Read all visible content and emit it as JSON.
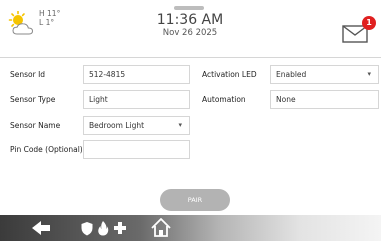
{
  "weather": {
    "high": "H 11°",
    "low": "L 1°",
    "icon": "partly-sunny-icon"
  },
  "clock": {
    "time": "11:36 AM",
    "date": "Nov 26 2025"
  },
  "notifications": {
    "icon": "envelope-icon",
    "count": "1"
  },
  "form": {
    "sensor_id_label": "Sensor Id",
    "sensor_id_value": "512-4815",
    "sensor_type_label": "Sensor Type",
    "sensor_type_value": "Light",
    "sensor_name_label": "Sensor Name",
    "sensor_name_value": "Bedroom Light",
    "pin_code_label": "Pin Code (Optional)",
    "pin_code_value": "",
    "activation_led_label": "Activation LED",
    "activation_led_value": "Enabled",
    "automation_label": "Automation",
    "automation_value": "None"
  },
  "pair_button": "PAIR",
  "bottom_nav": [
    "back-arrow-icon",
    "shield-icon",
    "fire-icon",
    "medical-cross-icon",
    "home-icon"
  ],
  "colors": {
    "sun": "#f5c400",
    "badge": "#e02020",
    "pair_button": "#b3b3b3"
  }
}
